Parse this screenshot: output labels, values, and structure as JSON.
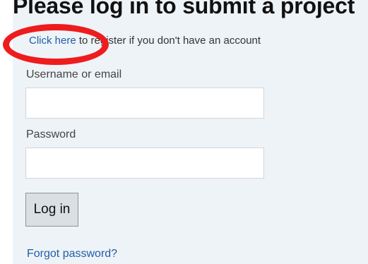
{
  "page": {
    "title": "Please log in to submit a project"
  },
  "register": {
    "link_text": "Click here",
    "rest_text": "to register if you don't have an account"
  },
  "login_form": {
    "username_label": "Username or email",
    "username_value": "",
    "password_label": "Password",
    "password_value": "",
    "submit_label": "Log in",
    "forgot_label": "Forgot password?"
  },
  "annotation": {
    "highlight_color": "#ee1c1c",
    "link_color": "#1f5ea8",
    "panel_color": "#eef3f7"
  }
}
